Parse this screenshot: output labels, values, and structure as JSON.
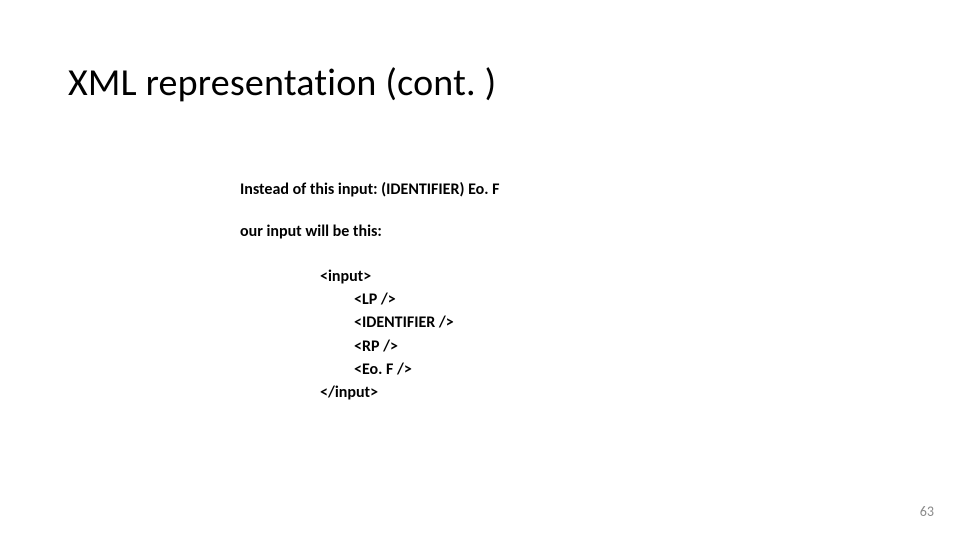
{
  "title": "XML representation (cont. )",
  "line1": "Instead of this input:  (IDENTIFIER) Eo. F",
  "line2": "our input will be this:",
  "code": {
    "l0": "<input>",
    "l1": "<LP />",
    "l2": "<IDENTIFIER />",
    "l3": "<RP />",
    "l4": "<Eo. F />",
    "l5": "</input>"
  },
  "page_number": "63"
}
